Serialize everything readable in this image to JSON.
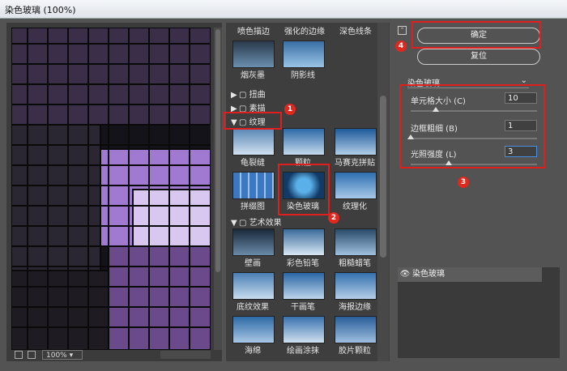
{
  "window": {
    "title": "染色玻璃 (100%)"
  },
  "preview": {
    "zoom": "100%"
  },
  "gallery": {
    "top_labels": [
      "喷色描边",
      "强化的边缘",
      "深色线条"
    ],
    "top_row_labels": [
      "烟灰墨",
      "阴影线"
    ],
    "categories": {
      "distort": "扭曲",
      "sketch": "素描",
      "texture": "纹理",
      "artistic": "艺术效果"
    },
    "texture_items": [
      "龟裂缝",
      "颗粒",
      "马赛克拼贴",
      "拼缀图",
      "染色玻璃",
      "纹理化"
    ],
    "artistic_items": [
      "壁画",
      "彩色铅笔",
      "粗糙蜡笔",
      "底纹效果",
      "干画笔",
      "海报边缘",
      "海绵",
      "绘画涂抹",
      "胶片颗粒"
    ]
  },
  "buttons": {
    "ok": "确定",
    "reset": "复位"
  },
  "filter": {
    "selected": "染色玻璃"
  },
  "params": {
    "cell_size": {
      "label": "单元格大小 (C)",
      "value": "10",
      "slider": 0.2
    },
    "border_thickness": {
      "label": "边框粗细 (B)",
      "value": "1",
      "slider": 0.0
    },
    "light_intensity": {
      "label": "光照强度 (L)",
      "value": "3",
      "slider": 0.3
    }
  },
  "layers": {
    "item": "染色玻璃"
  },
  "annotations": [
    "1",
    "2",
    "3",
    "4"
  ],
  "colors": {
    "annotation": "#e01e1e"
  }
}
